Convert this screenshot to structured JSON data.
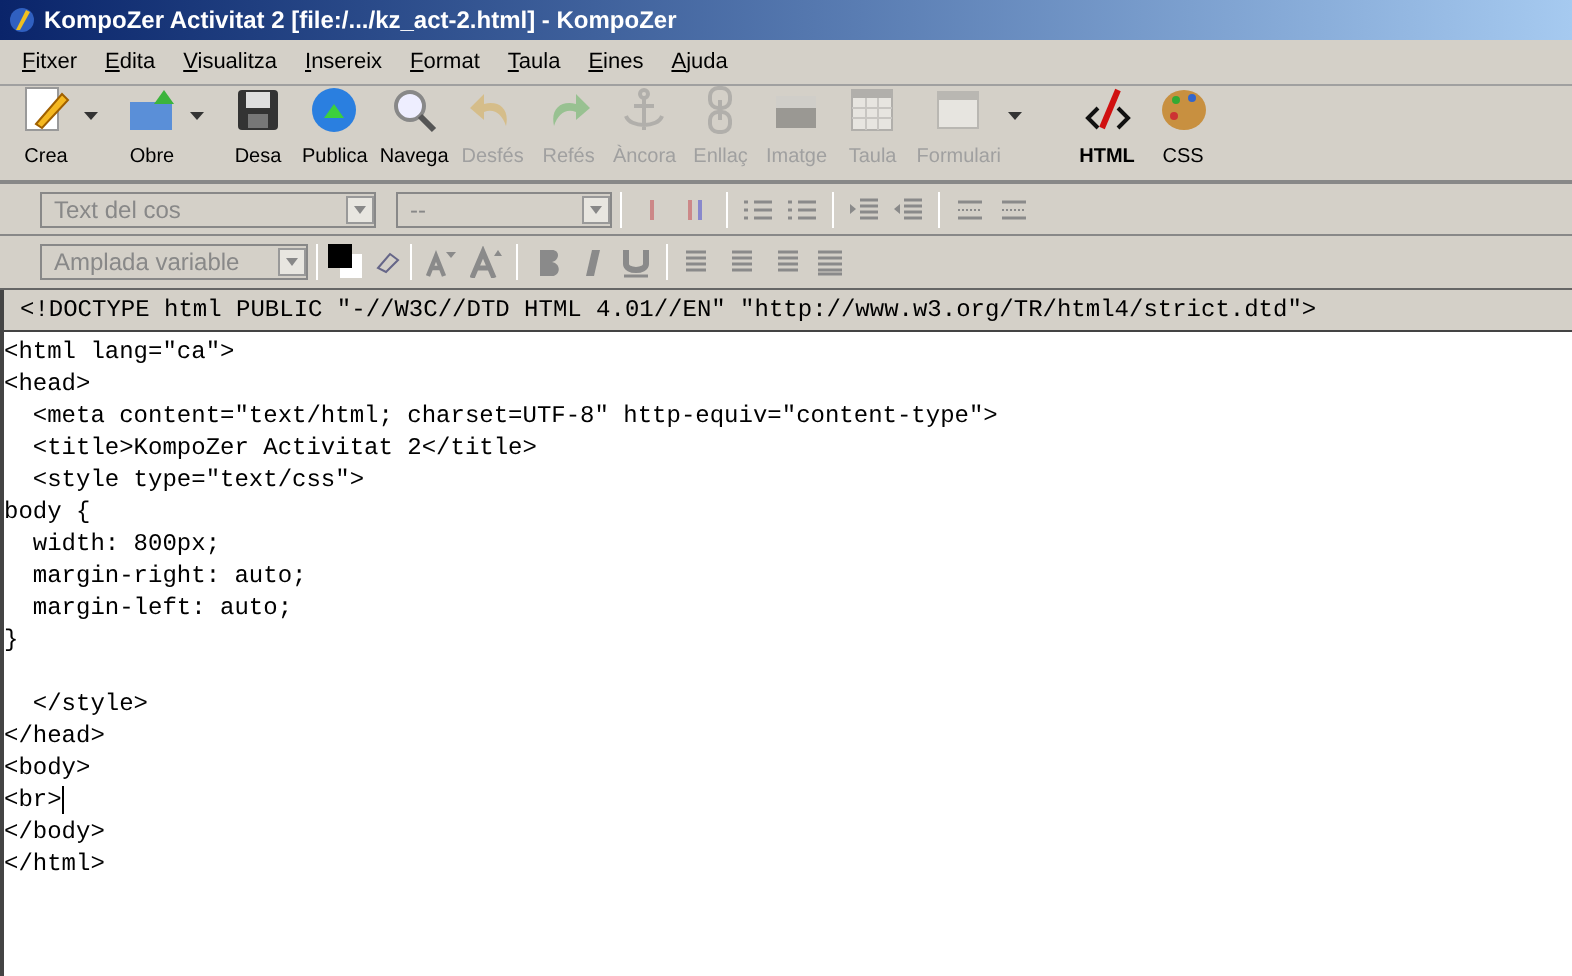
{
  "window": {
    "title": "KompoZer Activitat 2 [file:/.../kz_act-2.html] - KompoZer"
  },
  "menu": [
    "Fitxer",
    "Edita",
    "Visualitza",
    "Insereix",
    "Format",
    "Taula",
    "Eines",
    "Ajuda"
  ],
  "toolbar": [
    {
      "label": "Crea",
      "kind": "new",
      "disabled": false,
      "dropdown": true,
      "selected": false
    },
    {
      "label": "Obre",
      "kind": "open",
      "disabled": false,
      "dropdown": true,
      "selected": false
    },
    {
      "label": "Desa",
      "kind": "save",
      "disabled": false,
      "dropdown": false,
      "selected": false
    },
    {
      "label": "Publica",
      "kind": "publish",
      "disabled": false,
      "dropdown": false,
      "selected": false
    },
    {
      "label": "Navega",
      "kind": "browse",
      "disabled": false,
      "dropdown": false,
      "selected": false
    },
    {
      "label": "Desfés",
      "kind": "undo",
      "disabled": true,
      "dropdown": false,
      "selected": false
    },
    {
      "label": "Refés",
      "kind": "redo",
      "disabled": true,
      "dropdown": false,
      "selected": false
    },
    {
      "label": "Àncora",
      "kind": "anchor",
      "disabled": true,
      "dropdown": false,
      "selected": false
    },
    {
      "label": "Enllaç",
      "kind": "link",
      "disabled": true,
      "dropdown": false,
      "selected": false
    },
    {
      "label": "Imatge",
      "kind": "image",
      "disabled": true,
      "dropdown": false,
      "selected": false
    },
    {
      "label": "Taula",
      "kind": "table",
      "disabled": true,
      "dropdown": false,
      "selected": false
    },
    {
      "label": "Formulari",
      "kind": "form",
      "disabled": true,
      "dropdown": true,
      "selected": false
    },
    {
      "label": "HTML",
      "kind": "html",
      "disabled": false,
      "dropdown": false,
      "selected": true
    },
    {
      "label": "CSS",
      "kind": "css",
      "disabled": false,
      "dropdown": false,
      "selected": false
    }
  ],
  "format_bar_1": {
    "paragraph_select": {
      "value": "Text del cos"
    },
    "font_select": {
      "value": "--"
    },
    "buttons": [
      {
        "kind": "insert-break"
      },
      {
        "kind": "remove-break"
      },
      {
        "kind": "numbered-list"
      },
      {
        "kind": "bullet-list"
      },
      {
        "kind": "indent"
      },
      {
        "kind": "outdent"
      },
      {
        "kind": "rule"
      },
      {
        "kind": "rule"
      }
    ]
  },
  "format_bar_2": {
    "width_select": {
      "value": "Amplada variable"
    },
    "buttons": [
      {
        "kind": "smaller-text"
      },
      {
        "kind": "larger-text"
      },
      {
        "kind": "bold"
      },
      {
        "kind": "italic"
      },
      {
        "kind": "underline"
      },
      {
        "kind": "align-left"
      },
      {
        "kind": "align-center"
      },
      {
        "kind": "align-right"
      },
      {
        "kind": "justify"
      }
    ]
  },
  "editor": {
    "doctype": "<!DOCTYPE html PUBLIC \"-//W3C//DTD HTML 4.01//EN\" \"http://www.w3.org/TR/html4/strict.dtd\">",
    "lines": [
      {
        "text": "<html lang=\"ca\">",
        "cursor": false
      },
      {
        "text": "<head>",
        "cursor": false
      },
      {
        "text": "  <meta content=\"text/html; charset=UTF-8\" http-equiv=\"content-type\">",
        "cursor": false
      },
      {
        "text": "  <title>KompoZer Activitat 2</title>",
        "cursor": false
      },
      {
        "text": "  <style type=\"text/css\">",
        "cursor": false
      },
      {
        "text": "body {",
        "cursor": false
      },
      {
        "text": "  width: 800px;",
        "cursor": false
      },
      {
        "text": "  margin-right: auto;",
        "cursor": false
      },
      {
        "text": "  margin-left: auto;",
        "cursor": false
      },
      {
        "text": "}",
        "cursor": false
      },
      {
        "cursor": false
      },
      {
        "text": "  </style>",
        "cursor": false
      },
      {
        "text": "</head>",
        "cursor": false
      },
      {
        "text": "<body>",
        "cursor": false
      },
      {
        "text": "<br>",
        "cursor": true
      },
      {
        "text": "</body>",
        "cursor": false
      },
      {
        "text": "</html>",
        "cursor": false
      }
    ]
  }
}
